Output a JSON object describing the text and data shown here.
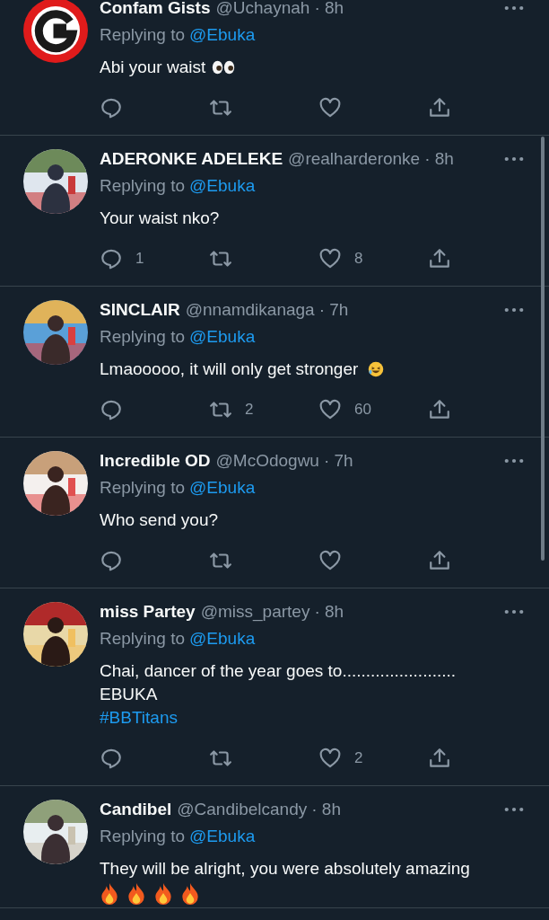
{
  "tweets": [
    {
      "name": "Confam Gists",
      "handle": "@Uchaynah",
      "time": "· 8h",
      "avatar": {
        "kind": "logo"
      },
      "replying_label": "Replying to",
      "replying_to": "@Ebuka",
      "body": [
        "Abi your waist"
      ],
      "emojis": [
        {
          "kind": "eyes"
        }
      ]
    },
    {
      "name": "ADERONKE ADELEKE",
      "handle": "@realharderonke",
      "time": "· 8h",
      "avatar": {
        "kind": "picture"
      },
      "replying_label": "Replying to",
      "replying_to": "@Ebuka",
      "body": [
        "Your waist nko?"
      ],
      "actions": {
        "replies": "1",
        "likes": "8"
      }
    },
    {
      "name": "SINCLAIR",
      "handle": "@nnamdikanaga",
      "time": "· 7h",
      "avatar": {
        "kind": "picture"
      },
      "replying_label": "Replying to",
      "replying_to": "@Ebuka",
      "body": [
        "Lmaooooo, it will only get stronger"
      ],
      "emojis": [
        {
          "kind": "laughing"
        }
      ],
      "actions": {
        "retweets": "2",
        "likes": "60"
      }
    },
    {
      "name": "Incredible OD",
      "handle": "@McOdogwu",
      "time": "· 7h",
      "avatar": {
        "kind": "picture"
      },
      "replying_label": "Replying to",
      "replying_to": "@Ebuka",
      "body": [
        "Who send you?"
      ]
    },
    {
      "name": "miss Partey",
      "handle": "@miss_partey",
      "time": "· 8h",
      "avatar": {
        "kind": "picture"
      },
      "replying_label": "Replying to",
      "replying_to": "@Ebuka",
      "body": [
        "Chai, dancer of the year goes to........................",
        "EBUKA"
      ],
      "hashtag": "#BBTitans",
      "actions": {
        "likes": "2"
      }
    },
    {
      "name": "Candibel",
      "handle": "@Candibelcandy",
      "time": "· 8h",
      "avatar": {
        "kind": "picture"
      },
      "replying_label": "Replying to",
      "replying_to": "@Ebuka",
      "body": [
        "They will be alright, you were absolutely amazing"
      ],
      "emoji_line": [
        {
          "kind": "fire"
        },
        {
          "kind": "fire"
        },
        {
          "kind": "fire"
        },
        {
          "kind": "fire"
        }
      ]
    }
  ]
}
